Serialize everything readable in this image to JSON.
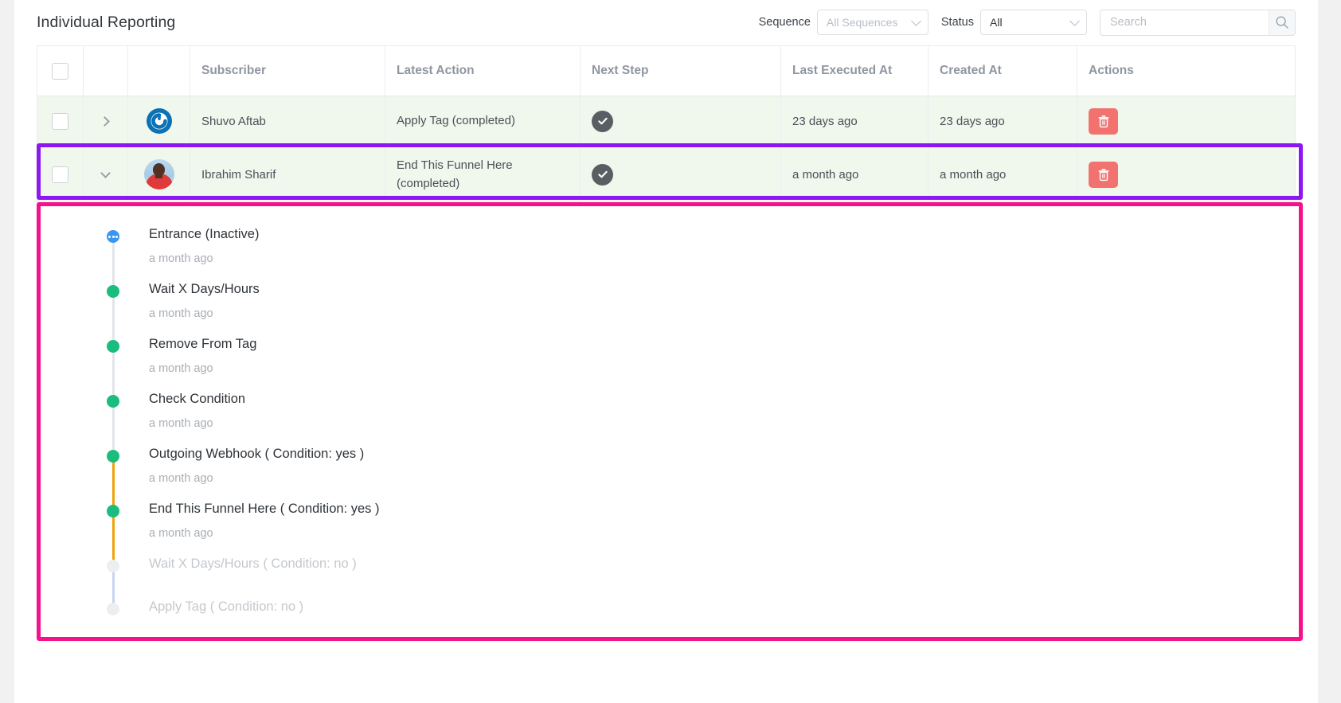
{
  "header": {
    "title": "Individual Reporting",
    "sequence_label": "Sequence",
    "sequence_value": "All Sequences",
    "status_label": "Status",
    "status_value": "All",
    "search_placeholder": "Search",
    "search_value": "",
    "search_icon": "search-icon",
    "chevron_icon": "chevron-down-icon"
  },
  "table": {
    "columns": [
      {
        "key": "select",
        "label": ""
      },
      {
        "key": "expand",
        "label": ""
      },
      {
        "key": "avatar",
        "label": ""
      },
      {
        "key": "subscriber",
        "label": "Subscriber"
      },
      {
        "key": "latest_action",
        "label": "Latest Action"
      },
      {
        "key": "next_step",
        "label": "Next Step"
      },
      {
        "key": "last_executed_at",
        "label": "Last Executed At"
      },
      {
        "key": "created_at",
        "label": "Created At"
      },
      {
        "key": "actions",
        "label": "Actions"
      }
    ],
    "rows": [
      {
        "expanded": false,
        "expand_icon": "chevron-right-icon",
        "avatar_type": "logo",
        "avatar_icon": "fluentcrm-logo-icon",
        "subscriber": "Shuvo Aftab",
        "latest_action": "Apply Tag (completed)",
        "next_step_icon": "check-circle-icon",
        "last_executed_at": "23 days ago",
        "created_at": "23 days ago",
        "delete_icon": "trash-icon"
      },
      {
        "expanded": true,
        "expand_icon": "chevron-down-icon",
        "avatar_type": "photo",
        "avatar_icon": "user-avatar-photo",
        "subscriber": "Ibrahim Sharif",
        "latest_action": "End This Funnel Here (completed)",
        "next_step_icon": "check-circle-icon",
        "last_executed_at": "a month ago",
        "created_at": "a month ago",
        "delete_icon": "trash-icon"
      }
    ]
  },
  "timeline": {
    "items": [
      {
        "title": "Entrance (Inactive)",
        "time": "a month ago",
        "dot": "blue",
        "line_color": "#e1e5ea"
      },
      {
        "title": "Wait X Days/Hours",
        "time": "a month ago",
        "dot": "green",
        "line_color": "#e1e5ea"
      },
      {
        "title": "Remove From Tag",
        "time": "a month ago",
        "dot": "green",
        "line_color": "#e1e5ea"
      },
      {
        "title": "Check Condition",
        "time": "a month ago",
        "dot": "green",
        "line_color": "#e1e5ea"
      },
      {
        "title": "Outgoing Webhook ( Condition: yes )",
        "time": "a month ago",
        "dot": "green",
        "line_color": "#f0a30a"
      },
      {
        "title": "End This Funnel Here ( Condition: yes )",
        "time": "a month ago",
        "dot": "green",
        "line_color": "#f0a30a"
      },
      {
        "title": "Wait X Days/Hours ( Condition: no )",
        "time": "",
        "dot": "grey",
        "line_color": "#c8d4f0"
      },
      {
        "title": "Apply Tag ( Condition: no )",
        "time": "",
        "dot": "grey",
        "line_color": ""
      }
    ]
  },
  "colors": {
    "row_highlight": "#f0f7ed",
    "delete_button": "#f2726f",
    "status_circle": "#595e63",
    "timeline_green": "#1bbd7e",
    "timeline_blue": "#3a97f0",
    "timeline_grey": "#eceef1",
    "annotation_purple": "#8c17f0",
    "annotation_pink": "#f5108c"
  }
}
